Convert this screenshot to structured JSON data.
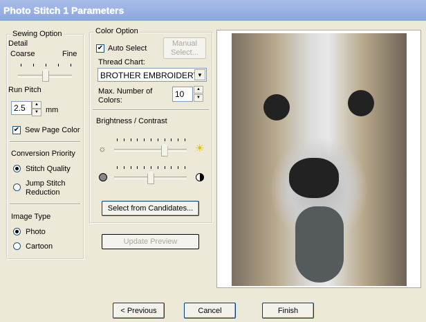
{
  "title": "Photo Stitch 1 Parameters",
  "sewing": {
    "legend": "Sewing Option",
    "detail_label": "Detail",
    "coarse": "Coarse",
    "fine": "Fine",
    "detail_value": 0.5,
    "run_pitch_label": "Run Pitch",
    "run_pitch_value": "2.5",
    "unit": "mm",
    "sew_page_color": "Sew Page Color",
    "sew_page_checked": true,
    "conversion_label": "Conversion Priority",
    "stitch_quality": "Stitch Quality",
    "jump_stitch": "Jump Stitch",
    "reduction": "Reduction",
    "image_type_label": "Image Type",
    "photo": "Photo",
    "cartoon": "Cartoon"
  },
  "color": {
    "legend": "Color Option",
    "auto_select": "Auto Select",
    "auto_checked": true,
    "manual_1": "Manual",
    "manual_2": "Select...",
    "thread_chart_label": "Thread Chart:",
    "thread_chart_value": "BROTHER EMBROIDERY",
    "max_colors_1": "Max. Number of",
    "max_colors_2": "Colors:",
    "max_colors_value": "10",
    "bc_label": "Brightness / Contrast",
    "brightness": 0.7,
    "contrast": 0.5,
    "select_candidates": "Select from Candidates..."
  },
  "update_preview": "Update Preview",
  "footer": {
    "previous": "< Previous",
    "cancel": "Cancel",
    "finish": "Finish"
  }
}
